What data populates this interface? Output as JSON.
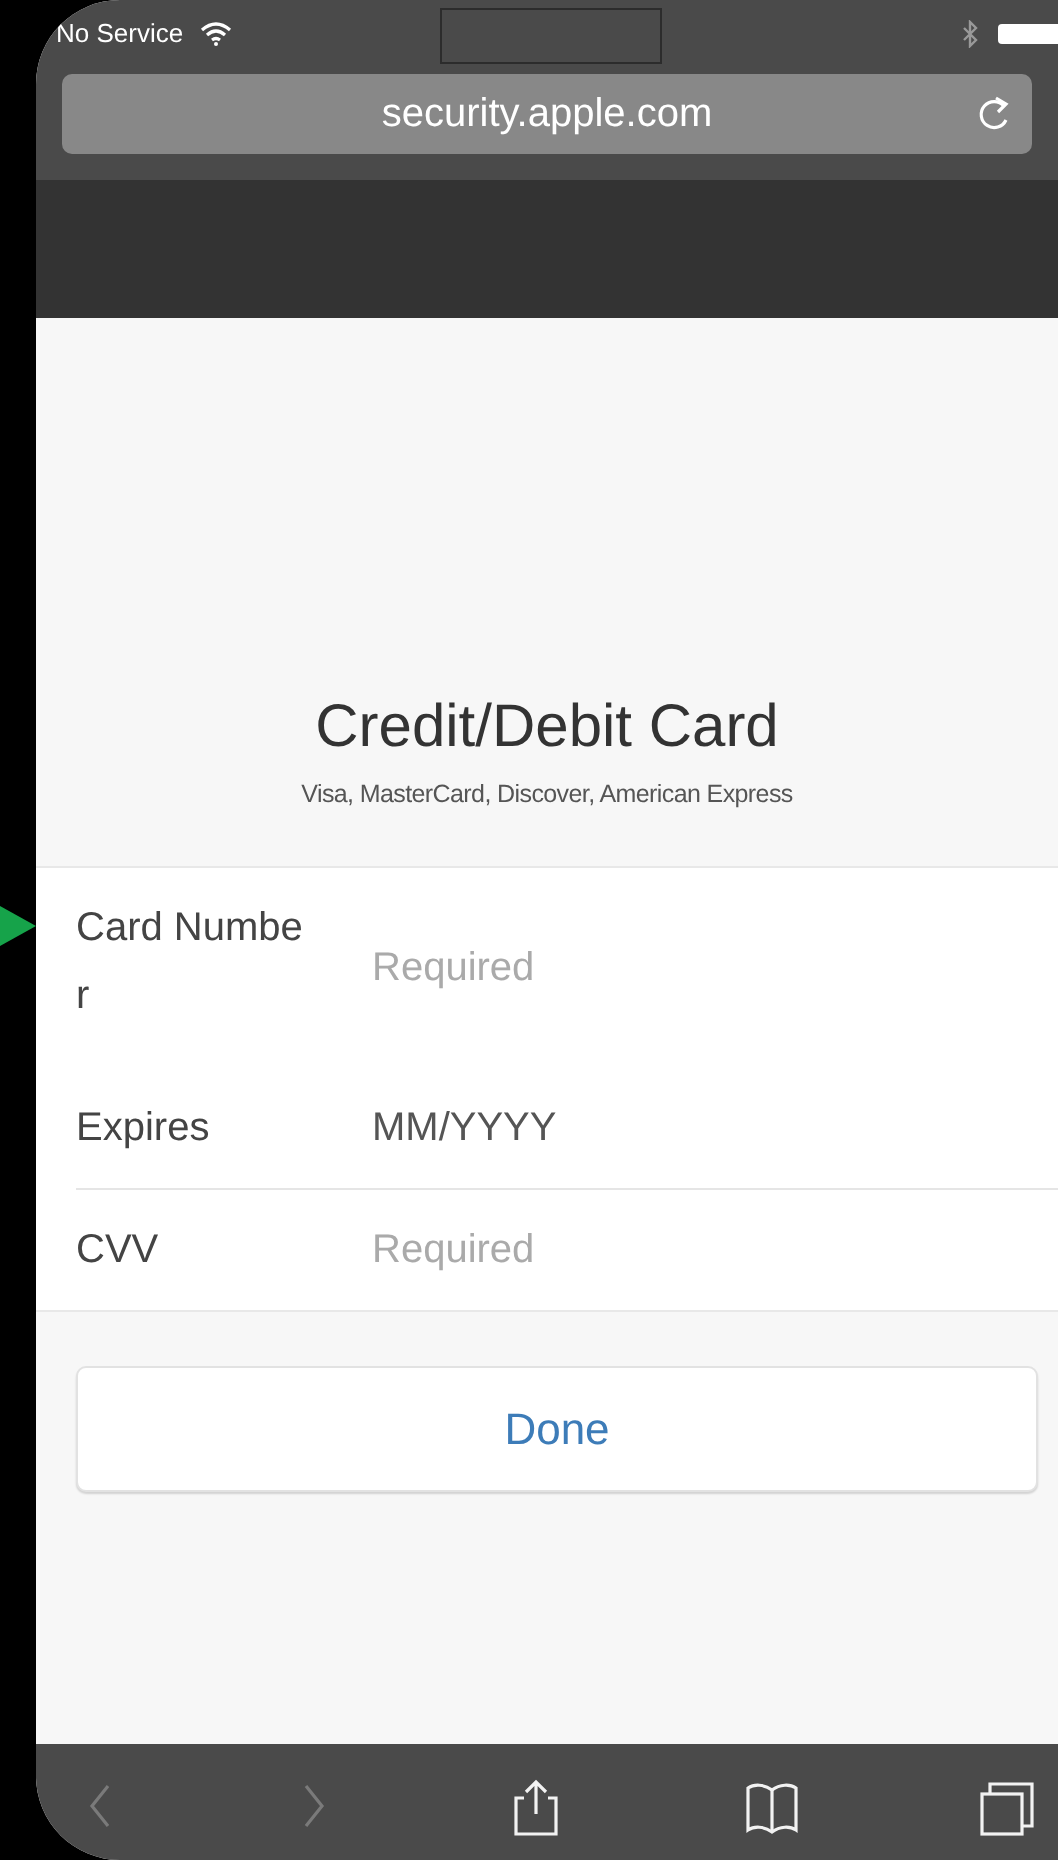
{
  "status_bar": {
    "carrier": "No Service"
  },
  "address_bar": {
    "url": "security.apple.com"
  },
  "card_form": {
    "title": "Credit/Debit Card",
    "subtitle": "Visa, MasterCard, Discover, American Express",
    "fields": [
      {
        "label": "Card Number",
        "placeholder": "Required"
      },
      {
        "label": "Expires",
        "value": "MM/YYYY"
      },
      {
        "label": "CVV",
        "placeholder": "Required"
      }
    ],
    "done_button": "Done"
  },
  "toolbar": [
    {
      "kind": "back",
      "disabled": true
    },
    {
      "kind": "forward",
      "disabled": true
    },
    {
      "kind": "share",
      "disabled": false
    },
    {
      "kind": "bookmarks",
      "disabled": false
    },
    {
      "kind": "tabs",
      "disabled": false
    }
  ]
}
